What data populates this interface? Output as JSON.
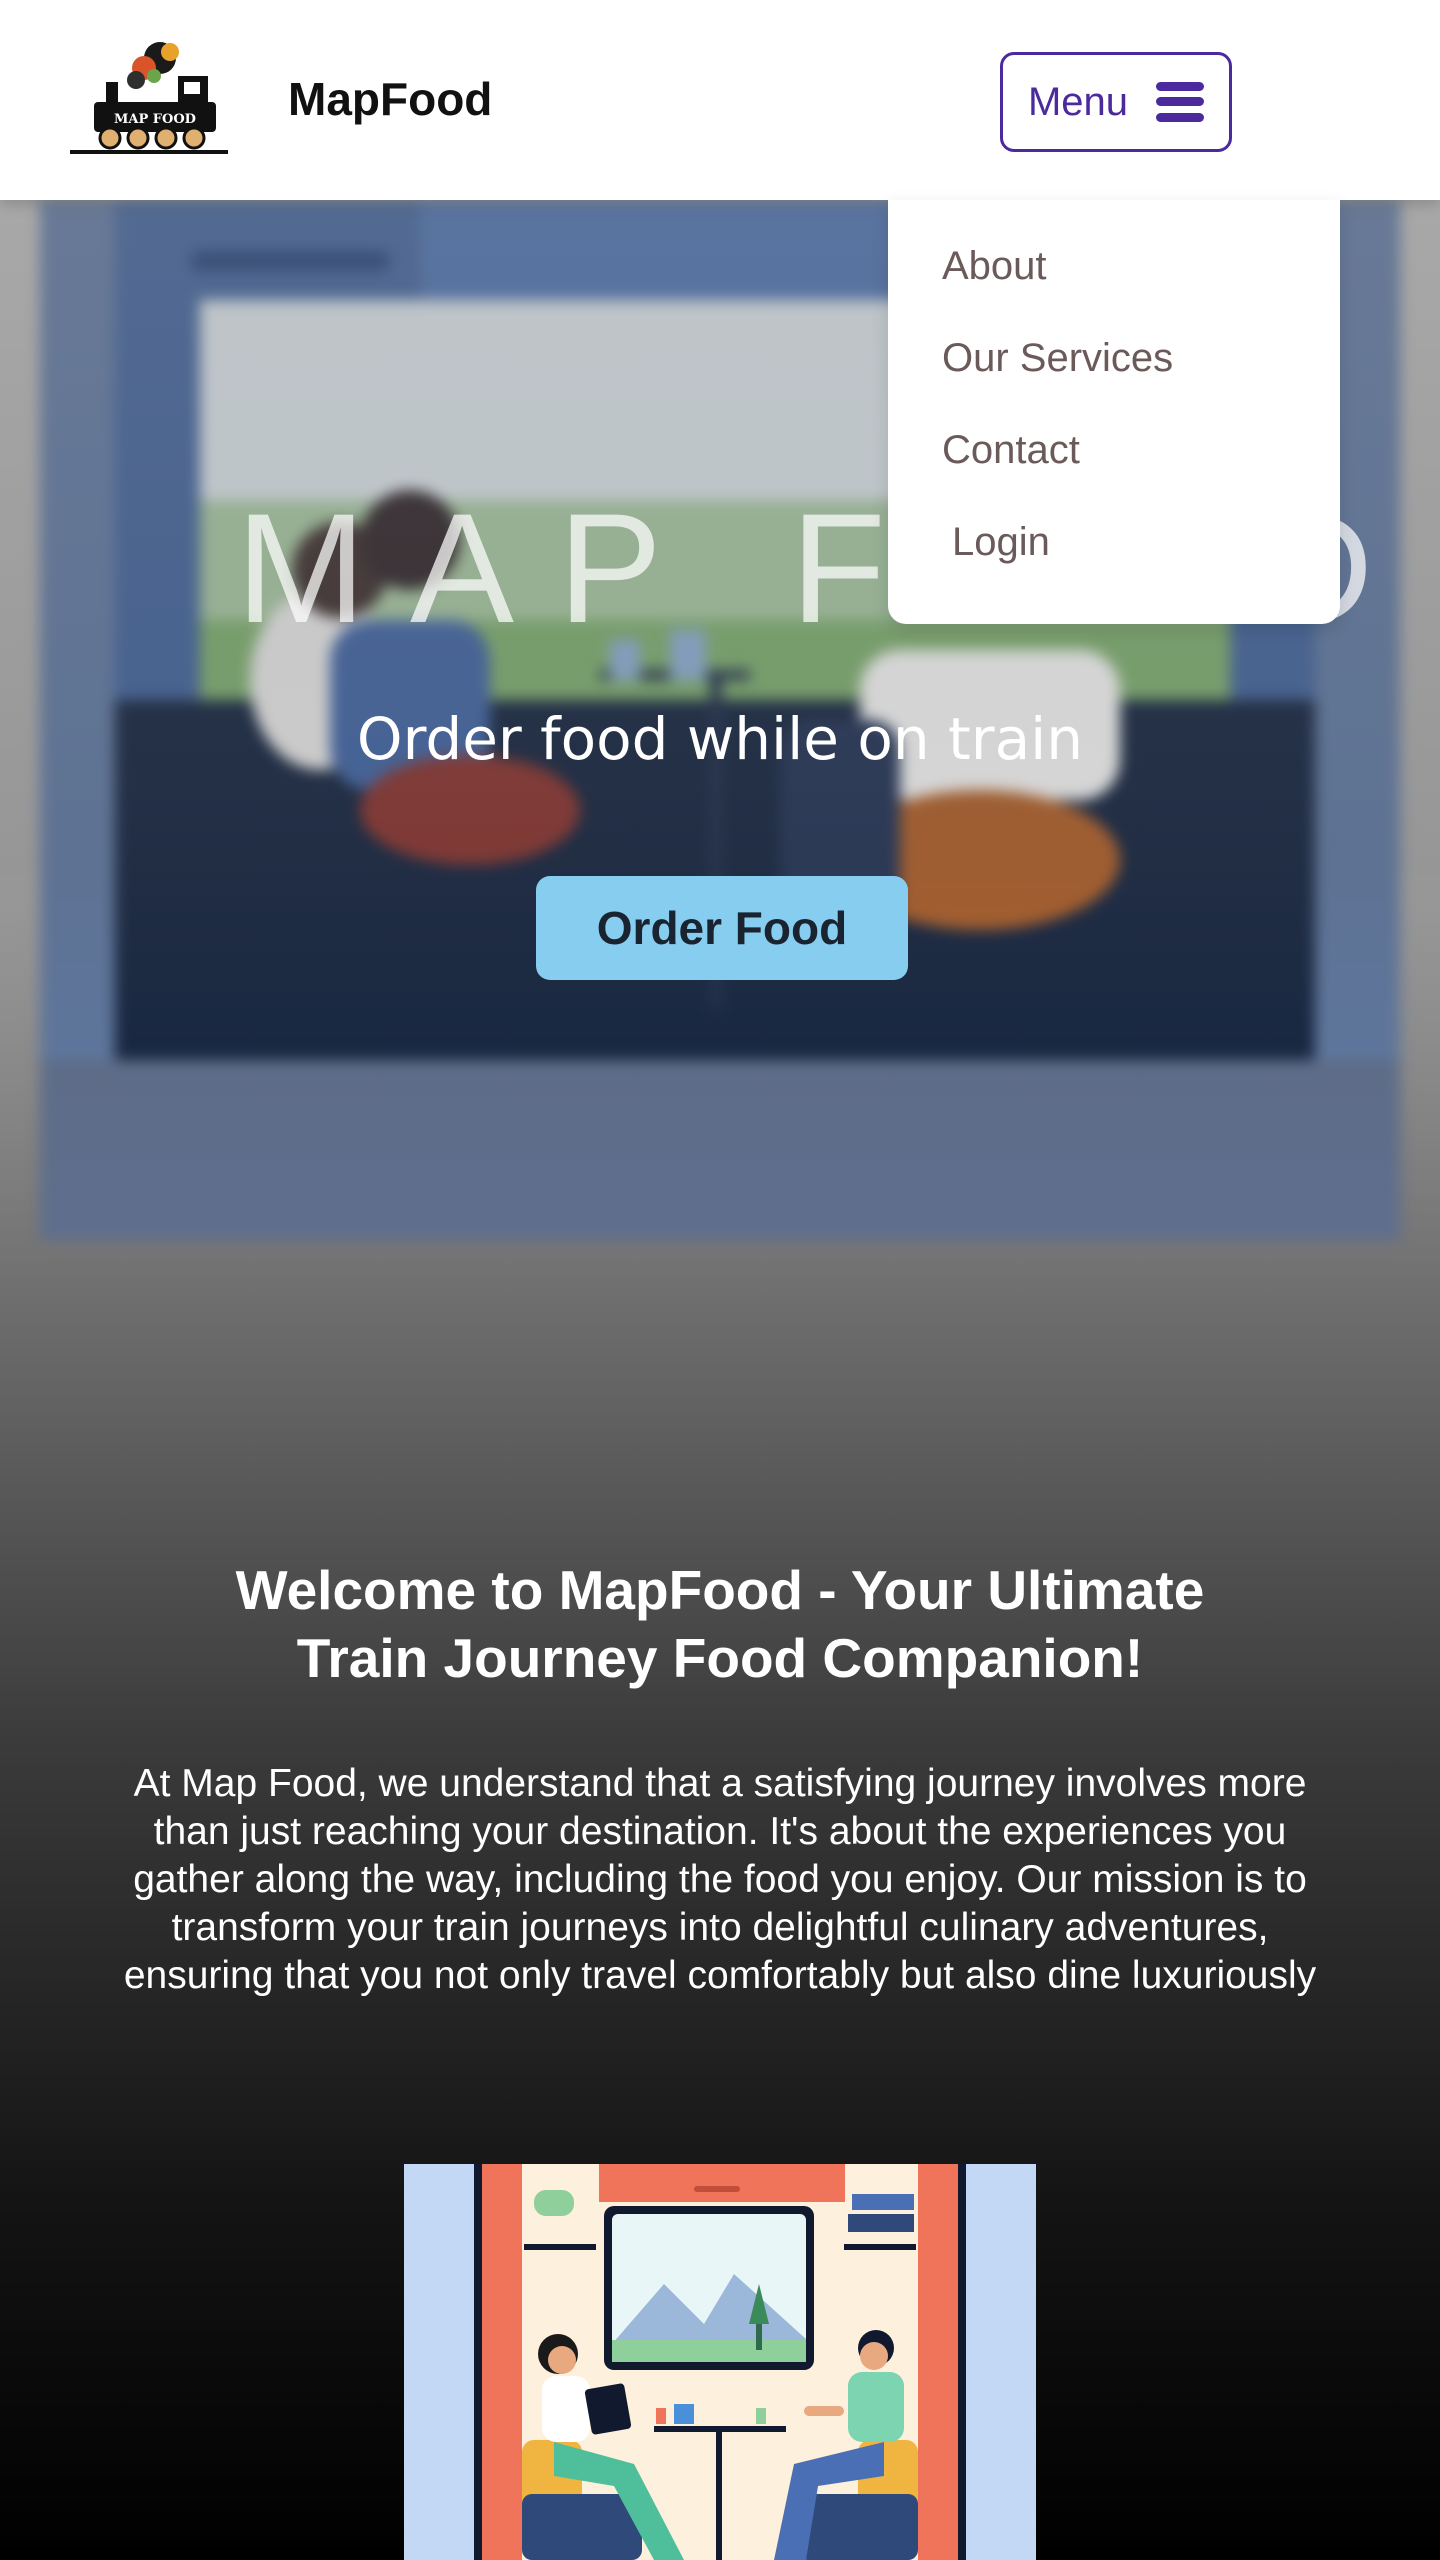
{
  "header": {
    "logo_text": "MAP FOOD",
    "brand": "MapFood",
    "menu_label": "Menu"
  },
  "dropdown": {
    "items": [
      "About",
      "Our Services",
      "Contact",
      "Login"
    ]
  },
  "hero": {
    "title": "MAP FOOD",
    "subtitle": "Order food while on train",
    "cta_label": "Order Food"
  },
  "welcome": {
    "title": "Welcome to MapFood - Your Ultimate Train Journey Food Companion!",
    "body": "At Map Food, we understand that a satisfying journey involves more than just reaching your destination. It's about the experiences you gather along the way, including the food you enjoy. Our mission is to transform your train journeys into delightful culinary adventures, ensuring that you not only travel comfortably but also dine luxuriously"
  },
  "colors": {
    "accent": "#4b2a9e",
    "cta": "#87cdef",
    "dropdown_text": "#6b5a5a"
  },
  "icons": {
    "menu": "hamburger-icon",
    "logo": "steam-train-logo"
  }
}
